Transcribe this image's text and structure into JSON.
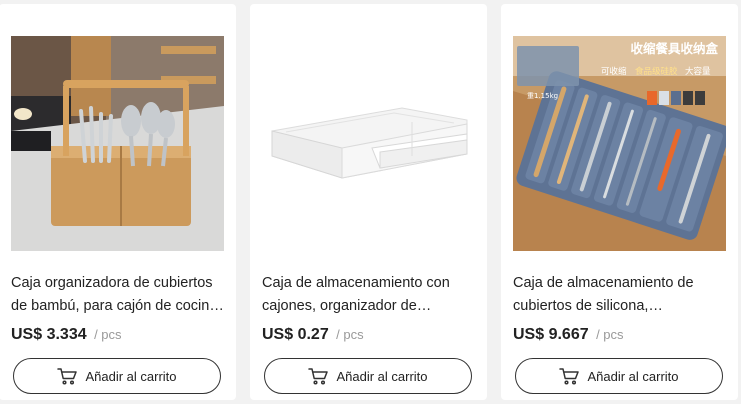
{
  "products": [
    {
      "title": "Caja organizadora de cubiertos de bambú, para cajón de cocina – cubiertos de madera",
      "price": "US$ 3.334",
      "unit": "/ pcs",
      "button_label": "Añadir al carrito",
      "cart_icon": "cart-icon"
    },
    {
      "title": "Caja de almacenamiento con cajones, organizador de escritorio",
      "price": "US$ 0.27",
      "unit": "/ pcs",
      "button_label": "Añadir al carrito",
      "cart_icon": "cart-icon"
    },
    {
      "title": "Caja de almacenamiento de cubiertos de silicona, organizador de cocina",
      "price": "US$ 9.667",
      "unit": "/ pcs",
      "button_label": "Añadir al carrito",
      "cart_icon": "cart-icon"
    }
  ],
  "image_text": {
    "headline": "收缩餐具收纳盒",
    "sub_a": "可收缩",
    "sub_b": "食品级硅胶",
    "sub_c": "大容量",
    "weight": "重1.15kg"
  }
}
